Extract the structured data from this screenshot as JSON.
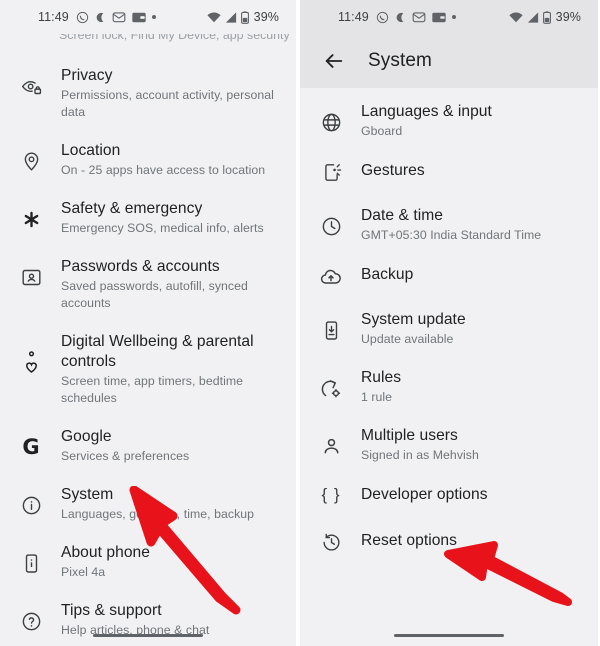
{
  "status_bar": {
    "time": "11:49",
    "battery_percent": "39%",
    "icons": [
      "whatsapp-icon",
      "moon-icon",
      "mail-icon",
      "wallet-icon",
      "dot-icon"
    ],
    "right_icons": [
      "wifi-icon",
      "signal-icon",
      "battery-icon"
    ]
  },
  "left_screen": {
    "partial_top_row": {
      "subtitle": "Screen lock, Find My Device, app security"
    },
    "items": [
      {
        "icon": "privacy-eye-lock-icon",
        "title": "Privacy",
        "subtitle": "Permissions, account activity, personal data"
      },
      {
        "icon": "location-pin-icon",
        "title": "Location",
        "subtitle": "On - 25 apps have access to location"
      },
      {
        "icon": "safety-asterisk-icon",
        "title": "Safety & emergency",
        "subtitle": "Emergency SOS, medical info, alerts"
      },
      {
        "icon": "passwords-account-icon",
        "title": "Passwords & accounts",
        "subtitle": "Saved passwords, autofill, synced accounts"
      },
      {
        "icon": "digital-wellbeing-icon",
        "title": "Digital Wellbeing & parental controls",
        "subtitle": "Screen time, app timers, bedtime schedules"
      },
      {
        "icon": "google-g-icon",
        "title": "Google",
        "subtitle": "Services & preferences"
      },
      {
        "icon": "info-circle-icon",
        "title": "System",
        "subtitle": "Languages, gestures, time, backup"
      },
      {
        "icon": "about-phone-icon",
        "title": "About phone",
        "subtitle": "Pixel 4a"
      },
      {
        "icon": "help-circle-icon",
        "title": "Tips & support",
        "subtitle": "Help articles, phone & chat"
      }
    ]
  },
  "right_screen": {
    "app_bar": {
      "back_icon": "back-arrow-icon",
      "title": "System"
    },
    "items": [
      {
        "icon": "globe-icon",
        "title": "Languages & input",
        "subtitle": "Gboard"
      },
      {
        "icon": "gestures-icon",
        "title": "Gestures",
        "subtitle": ""
      },
      {
        "icon": "clock-icon",
        "title": "Date & time",
        "subtitle": "GMT+05:30 India Standard Time"
      },
      {
        "icon": "cloud-upload-icon",
        "title": "Backup",
        "subtitle": ""
      },
      {
        "icon": "system-update-icon",
        "title": "System update",
        "subtitle": "Update available"
      },
      {
        "icon": "rules-icon",
        "title": "Rules",
        "subtitle": "1 rule"
      },
      {
        "icon": "person-icon",
        "title": "Multiple users",
        "subtitle": "Signed in as Mehvish"
      },
      {
        "icon": "developer-braces-icon",
        "title": "Developer options",
        "subtitle": ""
      },
      {
        "icon": "reset-history-icon",
        "title": "Reset options",
        "subtitle": ""
      }
    ]
  },
  "annotations": {
    "arrow_color": "#e8131a",
    "left_arrow": {
      "points_to": "System"
    },
    "right_arrow": {
      "points_to": "Reset options"
    }
  }
}
